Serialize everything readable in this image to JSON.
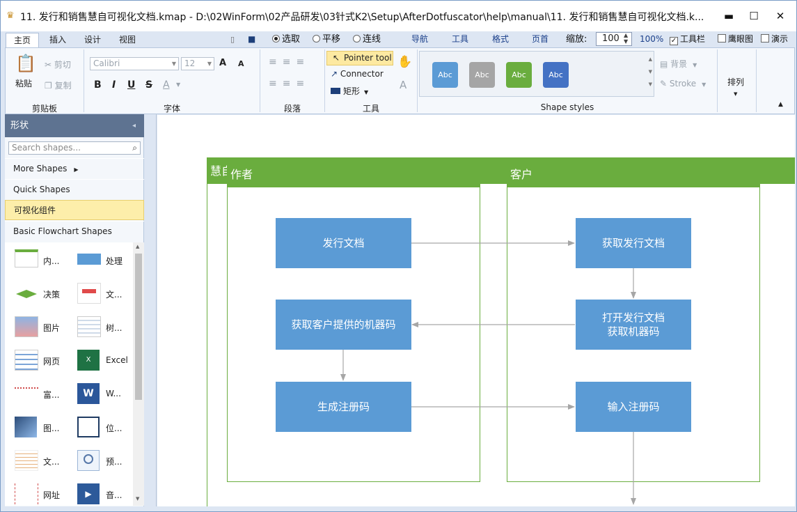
{
  "window": {
    "title": "11. 发行和销售慧自可视化文档.kmap -  D:\\02WinForm\\02产品研发\\03针式K2\\Setup\\AfterDotfuscator\\help\\manual\\11. 发行和销售慧自可视化文档.k...",
    "minimize": "▬",
    "maximize": "☐",
    "close": "✕"
  },
  "menu": {
    "tabs": [
      "主页",
      "插入",
      "设计",
      "视图"
    ],
    "modes": [
      "选取",
      "平移",
      "连线"
    ],
    "links": [
      "导航",
      "工具",
      "格式",
      "页首"
    ],
    "zoom_label": "缩放:",
    "zoom_value": "100",
    "zoom_percent": "100%",
    "checks": [
      "工具栏",
      "鹰眼图",
      "演示"
    ]
  },
  "ribbon": {
    "clipboard": {
      "paste": "粘贴",
      "cut": "剪切",
      "copy": "复制",
      "label": "剪贴板"
    },
    "font": {
      "name": "Calibri",
      "size": "12",
      "grow": "A",
      "shrink": "A",
      "bold": "B",
      "italic": "I",
      "underline": "U",
      "strike": "S",
      "color": "A",
      "label": "字体"
    },
    "paragraph": {
      "label": "段落"
    },
    "tools": {
      "pointer": "Pointer tool",
      "connector": "Connector",
      "rect": "矩形",
      "label": "工具"
    },
    "styles": {
      "swatches": [
        "Abc",
        "Abc",
        "Abc",
        "Abc"
      ],
      "label": "Shape styles",
      "background": "背景",
      "stroke": "Stroke"
    },
    "arrange": {
      "label": "排列"
    }
  },
  "panel": {
    "header": "形状",
    "search_placeholder": "Search shapes...",
    "categories": [
      "More Shapes",
      "Quick Shapes",
      "可视化组件",
      "Basic Flowchart Shapes"
    ],
    "shapes": [
      "内...",
      "处理",
      "决策",
      "文...",
      "图片",
      "树...",
      "网页",
      "Excel",
      "富...",
      "W...",
      "图...",
      "位...",
      "文...",
      "预...",
      "网址",
      "音..."
    ]
  },
  "diagram": {
    "pool_title": "慧自可视化文档发行步骤",
    "lanes": [
      "作者",
      "客户"
    ],
    "nodes": {
      "a1": "发行文档",
      "a2": "获取客户提供的机器码",
      "a3": "生成注册码",
      "c1": "获取发行文档",
      "c2_line1": "打开发行文档",
      "c2_line2": "获取机器码",
      "c3": "输入注册码"
    }
  },
  "colors": {
    "lane_green": "#6aad3e",
    "node_blue": "#5b9bd5",
    "swatch_1": "#5b9bd5",
    "swatch_2": "#a5a5a5",
    "swatch_3": "#6aad3e",
    "swatch_4": "#4472c4"
  }
}
